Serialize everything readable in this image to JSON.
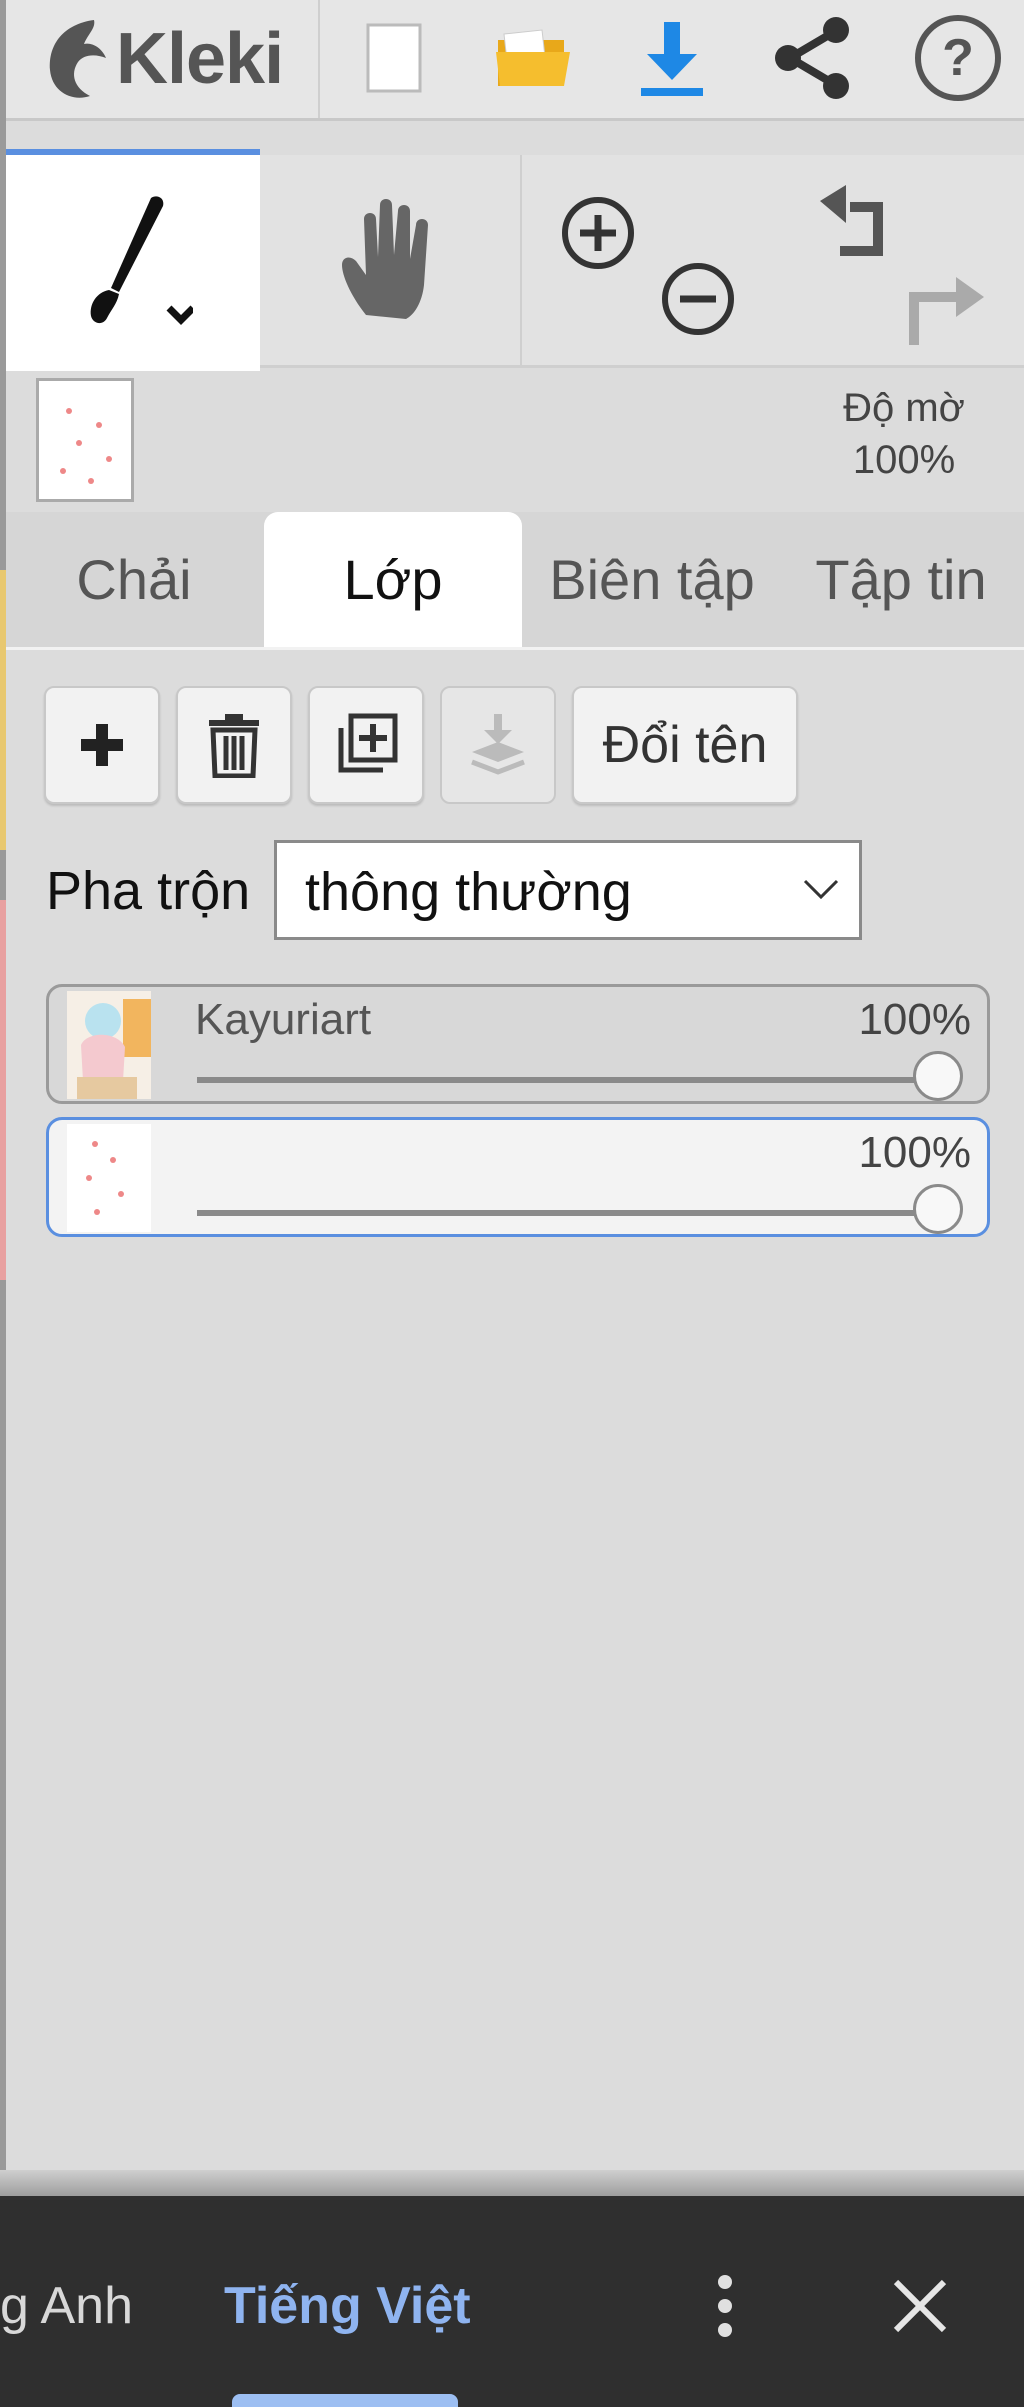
{
  "app": {
    "name": "Kleki"
  },
  "toolbar": {
    "new_icon": "new-file-icon",
    "open_icon": "folder-icon",
    "download_icon": "download-icon",
    "share_icon": "share-icon",
    "help_icon": "help-icon",
    "accent_color": "#1e88e5"
  },
  "tools": {
    "brush_icon": "brush-icon",
    "hand_icon": "hand-icon",
    "zoom_in_icon": "zoom-in-icon",
    "zoom_out_icon": "zoom-out-icon",
    "undo_icon": "undo-icon",
    "redo_icon": "redo-icon"
  },
  "preview": {
    "opacity_label": "Độ mờ",
    "opacity_value": "100%"
  },
  "tabs": [
    {
      "label": "Chải",
      "active": false
    },
    {
      "label": "Lớp",
      "active": true
    },
    {
      "label": "Biên tập",
      "active": false
    },
    {
      "label": "Tập tin",
      "active": false
    }
  ],
  "layer_actions": {
    "rename_label": "Đổi tên"
  },
  "blend": {
    "label": "Pha trộn",
    "value": "thông thường"
  },
  "layers": [
    {
      "name": "Kayuriart",
      "opacity": "100%",
      "opacity_fraction": 1.0,
      "selected": false
    },
    {
      "name": "",
      "opacity": "100%",
      "opacity_fraction": 1.0,
      "selected": true
    }
  ],
  "bottom_bar": {
    "language_prev": "g Anh",
    "language_current": "Tiếng Việt",
    "current_color": "#8fb4f0"
  }
}
